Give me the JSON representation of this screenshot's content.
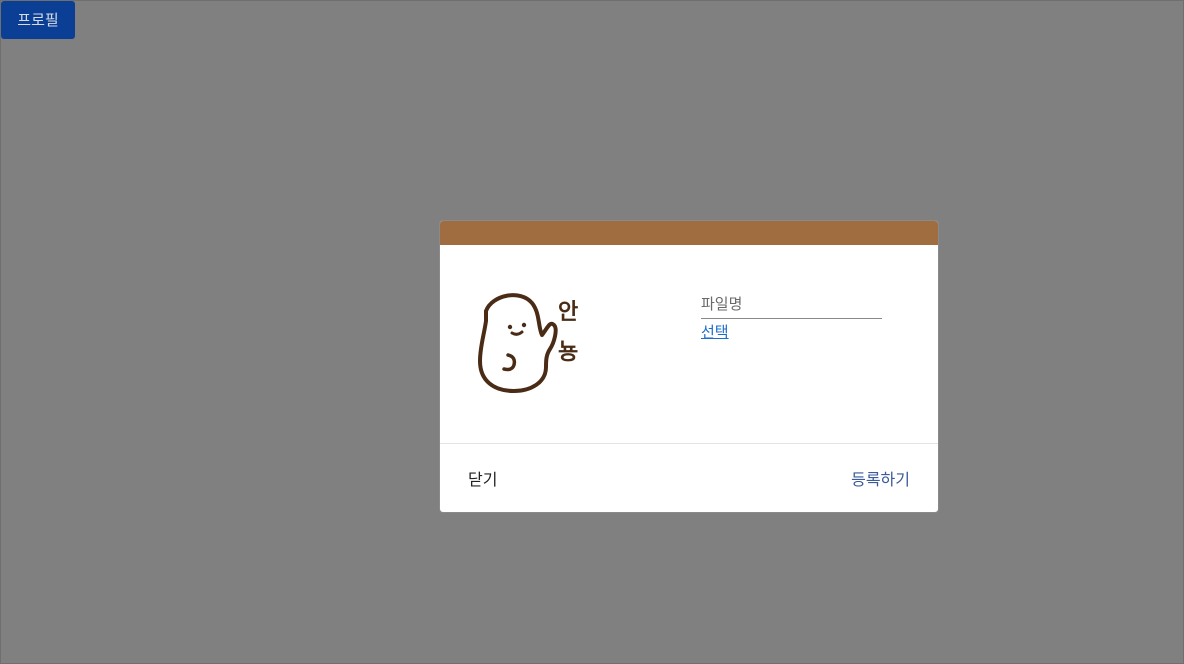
{
  "header": {
    "profile_label": "프로필"
  },
  "modal": {
    "header_color": "#a06d40",
    "avatar_text_line1": "안",
    "avatar_text_line2": "뇽",
    "file_placeholder": "파일명",
    "select_label": "선택",
    "close_label": "닫기",
    "register_label": "등록하기"
  }
}
